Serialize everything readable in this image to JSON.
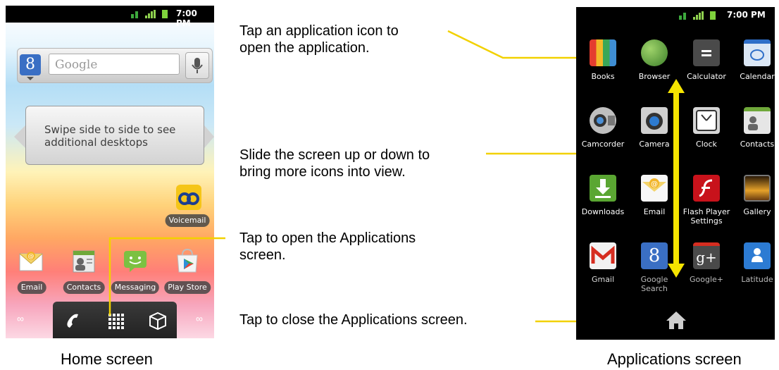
{
  "status_bar": {
    "time": "7:00 PM",
    "time_apps": "7:00 PM"
  },
  "home": {
    "search_placeholder": "Google",
    "search_logo": "8",
    "hint_line1": "Swipe side to side to see",
    "hint_line2": "additional desktops",
    "voicemail_label": "Voicemail",
    "dock_apps": [
      {
        "label": "Email",
        "icon": "email-icon"
      },
      {
        "label": "Contacts",
        "icon": "contacts-icon"
      },
      {
        "label": "Messaging",
        "icon": "messaging-icon"
      },
      {
        "label": "Play Store",
        "icon": "play-store-icon"
      }
    ],
    "page_indicator_left": "∞",
    "page_indicator_right": "∞",
    "caption": "Home screen"
  },
  "apps": {
    "grid": [
      {
        "label": "Books",
        "icon": "books-icon",
        "color": "#3f8ed3"
      },
      {
        "label": "Browser",
        "icon": "browser-icon",
        "color": "#4e9a38"
      },
      {
        "label": "Calculator",
        "icon": "calculator-icon",
        "color": "#4a4a4a"
      },
      {
        "label": "Calendar",
        "icon": "calendar-icon",
        "color": "#dbe7f5"
      },
      {
        "label": "Camcorder",
        "icon": "camcorder-icon",
        "color": "#bfbfbf"
      },
      {
        "label": "Camera",
        "icon": "camera-icon",
        "color": "#2d7bd1"
      },
      {
        "label": "Clock",
        "icon": "clock-icon",
        "color": "#d6d6d6"
      },
      {
        "label": "Contacts",
        "icon": "contacts-icon",
        "color": "#cfcfcf"
      },
      {
        "label": "Downloads",
        "icon": "downloads-icon",
        "color": "#5aa632"
      },
      {
        "label": "Email",
        "icon": "email-icon",
        "color": "#f1c24a"
      },
      {
        "label": "Flash Player Settings",
        "icon": "flash-icon",
        "color": "#c8121b"
      },
      {
        "label": "Gallery",
        "icon": "gallery-icon",
        "color": "#e6a22a"
      },
      {
        "label": "Gmail",
        "icon": "gmail-icon",
        "color": "#e7e7e7"
      },
      {
        "label": "Google Search",
        "icon": "google-search-icon",
        "color": "#3a6fc4"
      },
      {
        "label": "Google+",
        "icon": "google-plus-icon",
        "color": "#5a5a5a"
      },
      {
        "label": "Latitude",
        "icon": "latitude-icon",
        "color": "#2c7bd3"
      }
    ],
    "caption": "Applications screen"
  },
  "callouts": {
    "tap_icon_line1": "Tap an application icon to",
    "tap_icon_line2": "open the application.",
    "slide_line1": "Slide the screen up or down to",
    "slide_line2": "bring more icons into view.",
    "open_apps_line1": "Tap to open the Applications",
    "open_apps_line2": "screen.",
    "close_apps": "Tap to close the Applications screen."
  },
  "colors": {
    "callout_line": "#f2d100",
    "arrow": "#f5e400"
  }
}
